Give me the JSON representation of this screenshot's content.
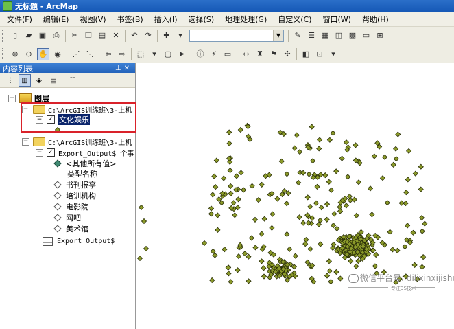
{
  "window": {
    "title": "无标题 - ArcMap"
  },
  "menu": [
    "文件(F)",
    "编辑(E)",
    "视图(V)",
    "书签(B)",
    "插入(I)",
    "选择(S)",
    "地理处理(G)",
    "自定义(C)",
    "窗口(W)",
    "帮助(H)"
  ],
  "toc": {
    "title": "内容列表",
    "root_label": "图层",
    "group1_path": "C:\\ArcGIS训练班\\3-上机",
    "layer1_label": "文化娱乐",
    "group2_path": "C:\\ArcGIS训练班\\3-上机",
    "layer2_label": "Export_Output$ 个事",
    "other_values": "<其他所有值>",
    "heading": "类型名称",
    "classes": [
      "书刊报亭",
      "培训机构",
      "电影院",
      "网吧",
      "美术馆"
    ],
    "table_label": "Export_Output$"
  },
  "watermark": {
    "main": "微信平台号: dilixinxijishu",
    "sub": "专注3S技术"
  },
  "colors": {
    "point_fill": "#8b9a2a",
    "point_stroke": "#2a2f08",
    "highlight": "#d9222a"
  }
}
